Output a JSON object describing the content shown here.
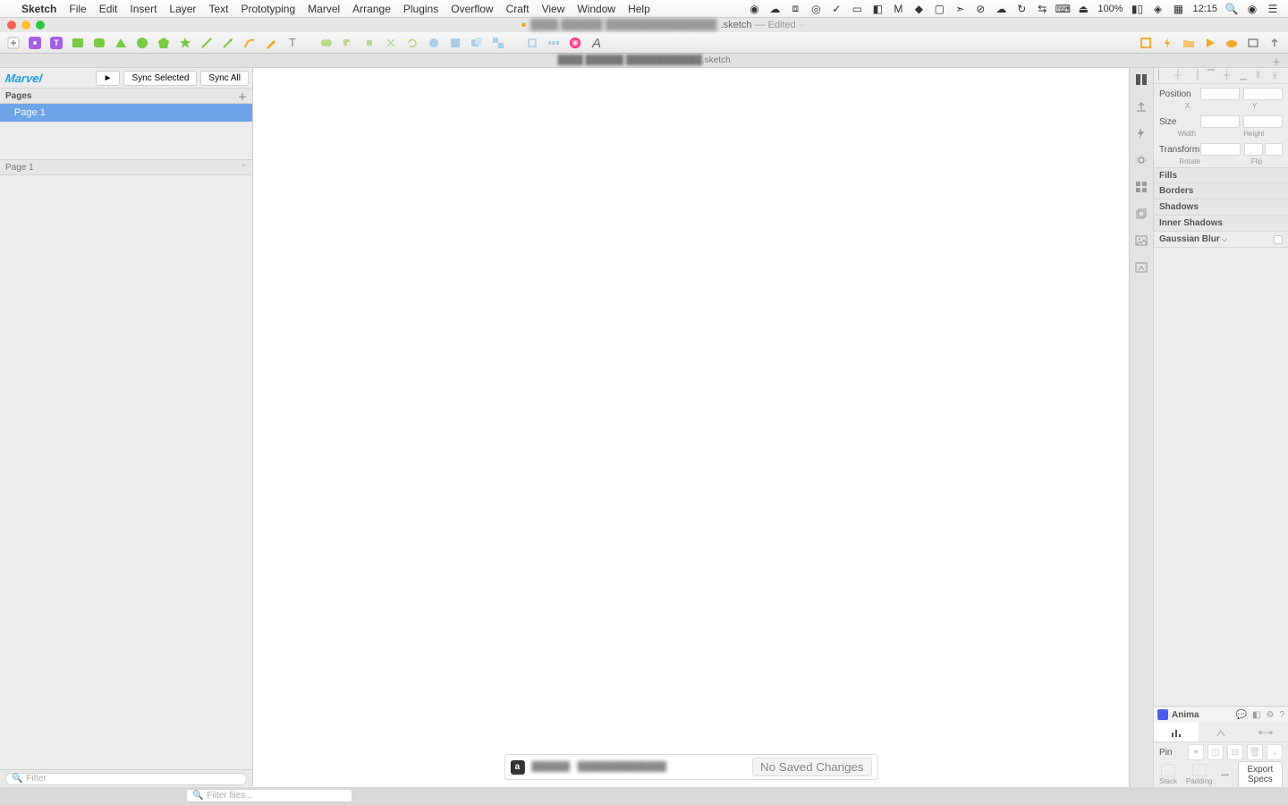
{
  "menubar": {
    "apple": "",
    "app": "Sketch",
    "items": [
      "File",
      "Edit",
      "Insert",
      "Layer",
      "Text",
      "Prototyping",
      "Marvel",
      "Arrange",
      "Plugins",
      "Overflow",
      "Craft",
      "View",
      "Window",
      "Help"
    ],
    "battery_pct": "100%",
    "clock": "12:15"
  },
  "window": {
    "filename_suffix": ".sketch",
    "edited": "— Edited",
    "tab_suffix": ".sketch"
  },
  "leftpane": {
    "marvel": "Marvel",
    "play": "►",
    "sync_selected": "Sync Selected",
    "sync_all": "Sync All",
    "pages_header": "Pages",
    "pages": [
      "Page 1"
    ],
    "layers_header": "Page 1",
    "filter_placeholder": "Filter"
  },
  "canvas": {
    "abstract_logo": "a",
    "no_saved": "No Saved Changes"
  },
  "inspector": {
    "position": "Position",
    "x": "X",
    "y": "Y",
    "size": "Size",
    "width": "Width",
    "height": "Height",
    "transform": "Transform",
    "rotate": "Rotate",
    "flip": "Flip",
    "fills": "Fills",
    "borders": "Borders",
    "shadows": "Shadows",
    "inner_shadows": "Inner Shadows",
    "gaussian": "Gaussian Blur"
  },
  "anima": {
    "title": "Anima",
    "pin": "Pin",
    "stack": "Stack",
    "padding": "Padding",
    "export": "Export Specs"
  },
  "ghost": {
    "filter_files": "Filter files..."
  }
}
